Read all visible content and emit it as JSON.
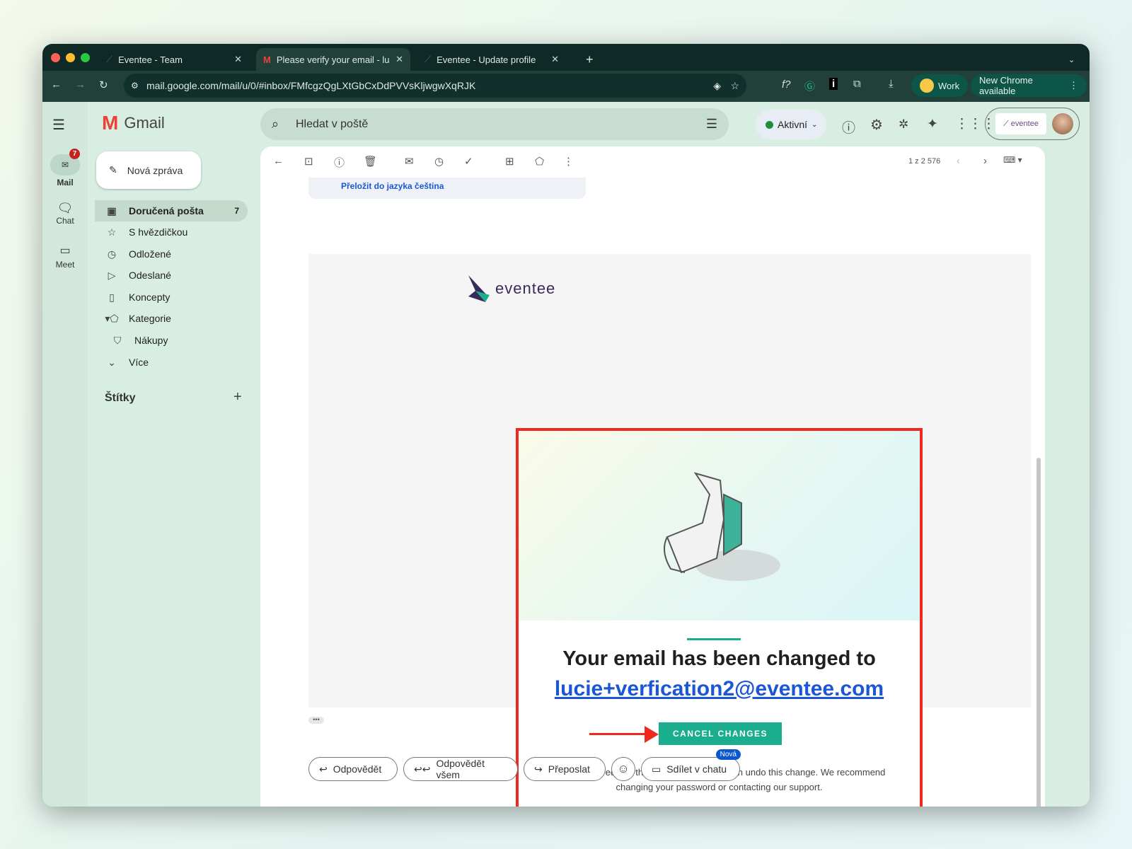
{
  "browser": {
    "tabs": [
      {
        "title": "Eventee - Team"
      },
      {
        "title": "Please verify your email - luci"
      },
      {
        "title": "Eventee - Update profile"
      }
    ],
    "url": "mail.google.com/mail/u/0/#inbox/FMfcgzQgLXtGbCxDdPVVsKljwgwXqRJK",
    "profile_label": "Work",
    "update_label": "New Chrome available"
  },
  "gmail": {
    "app_name": "Gmail",
    "rail": [
      {
        "label": "Mail",
        "badge": "7"
      },
      {
        "label": "Chat"
      },
      {
        "label": "Meet"
      }
    ],
    "compose_label": "Nová zpráva",
    "nav": [
      {
        "label": "Doručená pošta",
        "count": "7"
      },
      {
        "label": "S hvězdičkou"
      },
      {
        "label": "Odložené"
      },
      {
        "label": "Odeslané"
      },
      {
        "label": "Koncepty"
      },
      {
        "label": "Kategorie"
      },
      {
        "label": "Nákupy"
      },
      {
        "label": "Více"
      }
    ],
    "labels_heading": "Štítky",
    "search_placeholder": "Hledat v poště",
    "status_label": "Aktivní",
    "account_logo": "eventee",
    "pagination": "1 z 2 576",
    "translate_link": "Přeložit do jazyka čeština"
  },
  "email": {
    "logo_text": "eventee",
    "heading": "Your email has been changed to",
    "new_email": "lucie+verfication2@eventee.com",
    "cancel_button": "CANCEL CHANGES",
    "body": "If you didn't request the email change, you can undo this change. We recommend changing your password or contacting our support.",
    "accent": "#1aae8f",
    "highlight": "#f0281e"
  },
  "actions": {
    "reply": "Odpovědět",
    "reply_all": "Odpovědět všem",
    "forward": "Přeposlat",
    "share": "Sdílet v chatu",
    "new_badge": "Nová"
  }
}
